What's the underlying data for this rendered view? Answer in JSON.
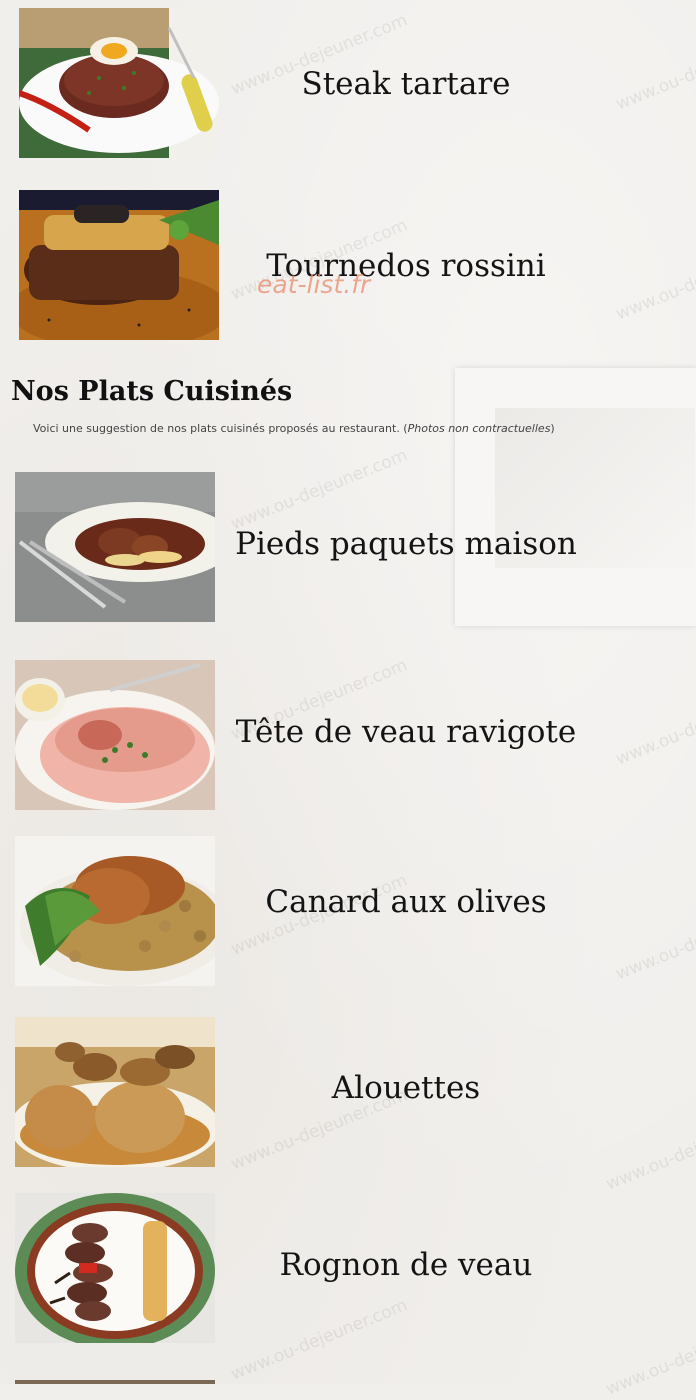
{
  "top_dishes": [
    {
      "name": "Steak tartare",
      "image_desc": "steak-tartare-photo"
    },
    {
      "name": "Tournedos rossini",
      "image_desc": "tournedos-rossini-photo"
    }
  ],
  "overlay_watermark": "eat-list.fr",
  "background_watermark": "www.ou-dejeuner.com",
  "section": {
    "title": "Nos Plats Cuisinés",
    "subtitle": "Voici une suggestion de nos plats cuisinés proposés au restaurant. (",
    "subtitle_note": "Photos non contractuelles",
    "subtitle_end": ")"
  },
  "cooked_dishes": [
    {
      "name": "Pieds paquets maison"
    },
    {
      "name": "Tête de veau ravigote"
    },
    {
      "name": "Canard aux olives"
    },
    {
      "name": "Alouettes"
    },
    {
      "name": "Rognon de veau"
    }
  ],
  "colors": {
    "background": "#f1efec",
    "text": "#141414",
    "overlay_watermark": "#e88c6e"
  }
}
